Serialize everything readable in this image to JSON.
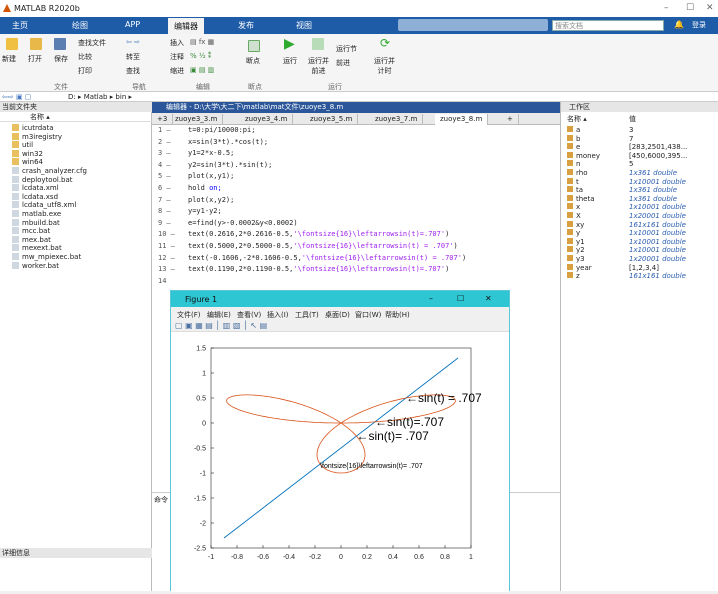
{
  "app": {
    "title": "MATLAB R2020b",
    "search_placeholder": "搜索文档",
    "login": "登录"
  },
  "tabs": [
    "主页",
    "绘图",
    "APP",
    "编辑器",
    "发布",
    "视图"
  ],
  "ribbon": {
    "new": "新建",
    "open": "打开",
    "save": "保存",
    "find_files": "查找文件",
    "compare": "比较",
    "print": "打印",
    "goto": "转至",
    "find": "查找",
    "insert": "插入",
    "comment": "注释",
    "indent": "缩进",
    "breakpoints": "断点",
    "run": "运行",
    "run_advance": "运行并\n前进",
    "run_section": "运行节",
    "advance": "前进",
    "run_time": "运行并\n计时",
    "groups": {
      "file": "文件",
      "navigate": "导航",
      "edit": "编辑",
      "breakpoints": "断点",
      "run": "运行"
    }
  },
  "address": "D: ▸ Matlab ▸ bin ▸",
  "current_folder": {
    "title": "当前文件夹",
    "col_name": "名称 ▴",
    "items": [
      "icutrdata",
      "m3iregistry",
      "util",
      "win32",
      "win64",
      "crash_analyzer.cfg",
      "deploytool.bat",
      "lcdata.xml",
      "lcdata.xsd",
      "lcdata_utf8.xml",
      "matlab.exe",
      "mbuild.bat",
      "mcc.bat",
      "mex.bat",
      "mexext.bat",
      "mw_mpiexec.bat",
      "worker.bat"
    ],
    "details": "详细信息"
  },
  "editor": {
    "title": "编辑器 - D:\\大学\\大二下\\matlab\\mat文件\\zuoye3_8.m",
    "tabs": [
      "+3",
      "zuoye3_3.m",
      "zuoye3_4.m",
      "zuoye3_5.m",
      "zuoye3_7.m",
      "zuoye3_8.m"
    ],
    "lines": [
      {
        "n": "1",
        "code": "t=0:pi/10000:pi;"
      },
      {
        "n": "2",
        "code": "x=sin(3*t).*cos(t);"
      },
      {
        "n": "3",
        "code": "y1=2*x-0.5;"
      },
      {
        "n": "4",
        "code": "y2=sin(3*t).*sin(t);"
      },
      {
        "n": "5",
        "code": "plot(x,y1);"
      },
      {
        "n": "6",
        "code": "hold on;"
      },
      {
        "n": "7",
        "code": "plot(x,y2);"
      },
      {
        "n": "8",
        "code": "y=y1-y2;"
      },
      {
        "n": "9",
        "code": "e=find(y>-0.0002&y<0.0002)"
      },
      {
        "n": "10",
        "code": "text(0.2616,2*0.2616-0.5,'\\fontsize{16}\\leftarrowsin(t)=.707')"
      },
      {
        "n": "11",
        "code": "text(0.5000,2*0.5000-0.5,'\\fontsize{16}\\leftarrowsin(t) = .707')"
      },
      {
        "n": "12",
        "code": "text(-0.1606,-2*0.1606-0.5,'\\fontsize{16}\\leftarrowsin(t) = .707')"
      },
      {
        "n": "13",
        "code": "text(0.1190,2*0.1190-0.5,'\\fontsize{16}\\leftarrowsin(t)=.707')"
      },
      {
        "n": "14",
        "code": ""
      }
    ],
    "cmd_label": "命令"
  },
  "workspace": {
    "title": "工作区",
    "col_name": "名称 ▴",
    "col_value": "值",
    "vars": [
      {
        "name": "a",
        "value": "3"
      },
      {
        "name": "b",
        "value": "7"
      },
      {
        "name": "e",
        "value": "[283,2501,438..."
      },
      {
        "name": "money",
        "value": "[450,6000,395..."
      },
      {
        "name": "n",
        "value": "5"
      },
      {
        "name": "rho",
        "value": "1x361 double"
      },
      {
        "name": "t",
        "value": "1x10001 double"
      },
      {
        "name": "ta",
        "value": "1x361 double"
      },
      {
        "name": "theta",
        "value": "1x361 double"
      },
      {
        "name": "x",
        "value": "1x10001 double"
      },
      {
        "name": "X",
        "value": "1x20001 double"
      },
      {
        "name": "xy",
        "value": "161x161 double"
      },
      {
        "name": "y",
        "value": "1x10001 double"
      },
      {
        "name": "y1",
        "value": "1x10001 double"
      },
      {
        "name": "y2",
        "value": "1x10001 double"
      },
      {
        "name": "y3",
        "value": "1x20001 double"
      },
      {
        "name": "year",
        "value": "[1,2,3,4]"
      },
      {
        "name": "z",
        "value": "161x161 double"
      }
    ]
  },
  "figure": {
    "title": "Figure 1",
    "menu": [
      "文件(F)",
      "编辑(E)",
      "查看(V)",
      "插入(I)",
      "工具(T)",
      "桌面(D)",
      "窗口(W)",
      "帮助(H)"
    ]
  },
  "chart_data": {
    "type": "line",
    "xlim": [
      -1,
      1
    ],
    "ylim": [
      -2.5,
      1.5
    ],
    "xticks": [
      "-1",
      "-0.8",
      "-0.6",
      "-0.4",
      "-0.2",
      "0",
      "0.2",
      "0.4",
      "0.6",
      "0.8",
      "1"
    ],
    "yticks": [
      "1.5",
      "1",
      "0.5",
      "0",
      "-0.5",
      "-1",
      "-1.5",
      "-2",
      "-2.5"
    ],
    "series": [
      {
        "color": "#0072bd",
        "x": [
          -0.9,
          0.9
        ],
        "y": [
          -2.3,
          1.3
        ]
      },
      {
        "color": "#d95319",
        "note": "parametric x=sin(3t)cos(t), y=sin(3t)sin(t)"
      }
    ],
    "annotations": [
      {
        "text": "←sin(t) = .707",
        "x": 0.5,
        "y": 0.5,
        "size": "large"
      },
      {
        "text": "←sin(t)=.707",
        "x": 0.2616,
        "y": 0.0232,
        "size": "large"
      },
      {
        "text": "←sin(t)= .707",
        "x": 0.119,
        "y": -0.262,
        "size": "large"
      },
      {
        "text": "\\fontsize{16}\\leftarrowsin(t)= .707",
        "x": -0.1606,
        "y": -0.82,
        "size": "small"
      }
    ],
    "grid": false
  }
}
